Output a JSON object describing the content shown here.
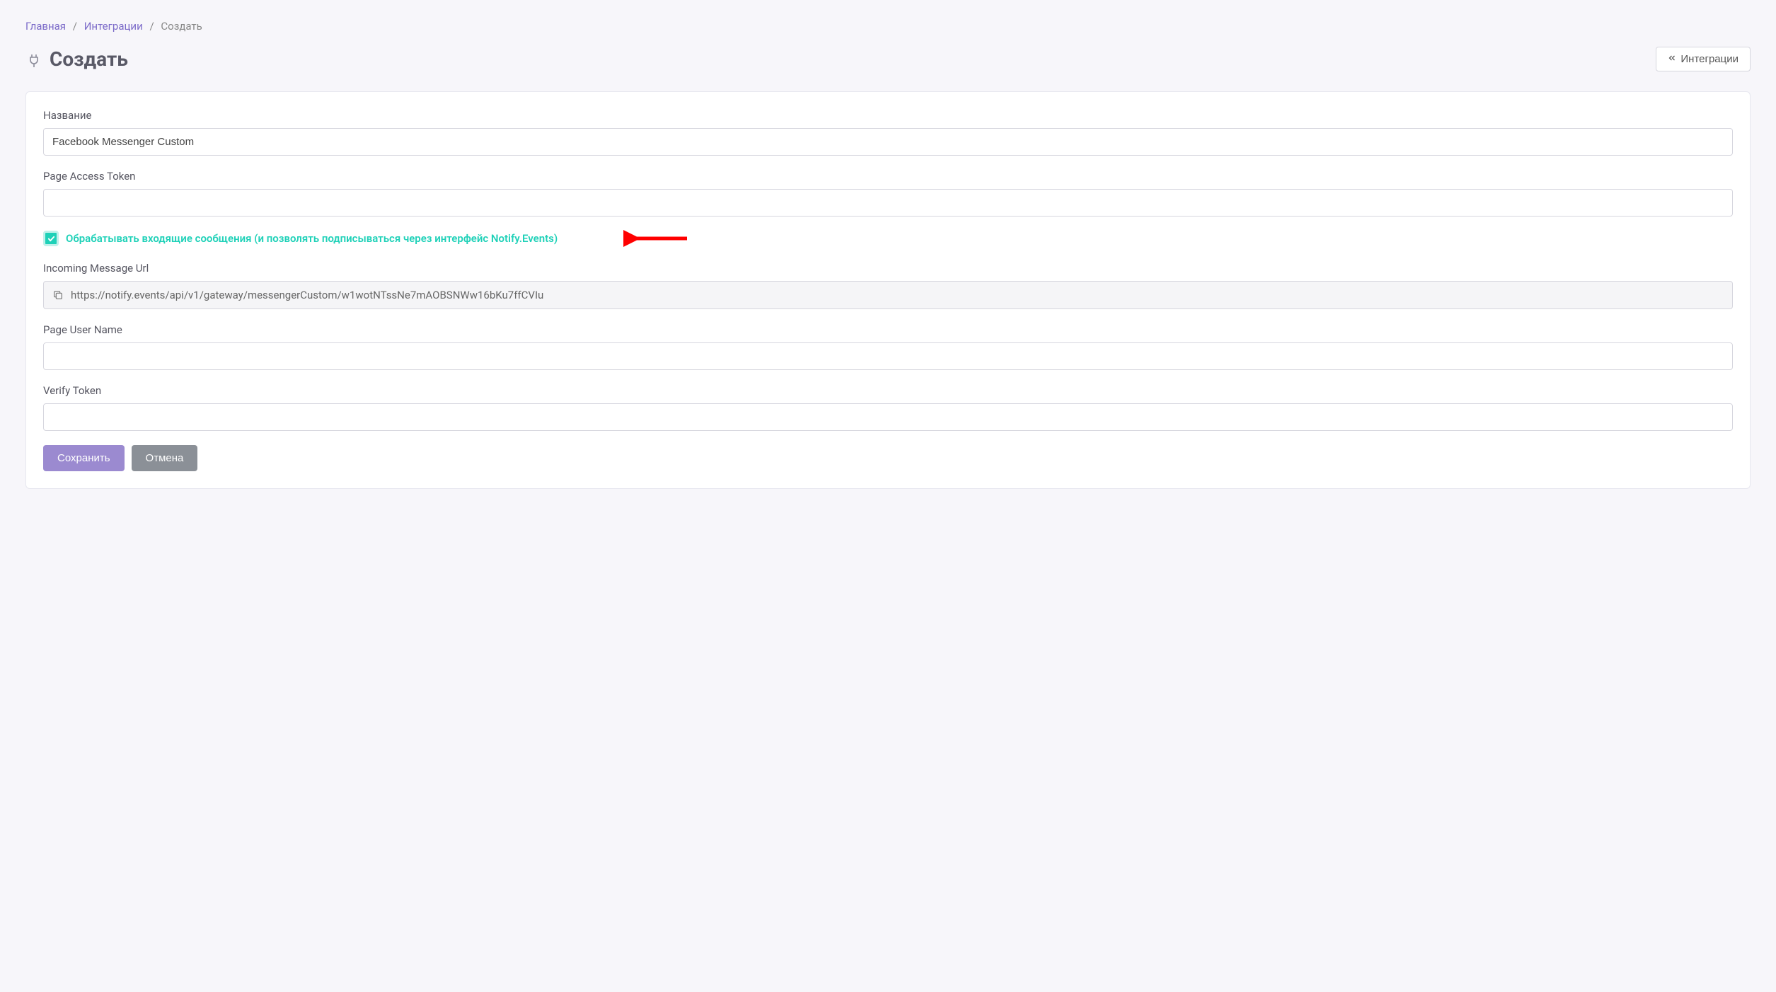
{
  "breadcrumb": {
    "home": "Главная",
    "integrations": "Интеграции",
    "current": "Создать"
  },
  "page": {
    "title": "Создать"
  },
  "back_button": {
    "label": "Интеграции"
  },
  "form": {
    "name": {
      "label": "Название",
      "value": "Facebook Messenger Custom"
    },
    "page_access_token": {
      "label": "Page Access Token",
      "value": ""
    },
    "incoming_checkbox": {
      "label": "Обрабатывать входящие сообщения (и позволять подписываться через интерфейс Notify.Events)",
      "checked": true
    },
    "incoming_url": {
      "label": "Incoming Message Url",
      "value": "https://notify.events/api/v1/gateway/messengerCustom/w1wotNTssNe7mAOBSNWw16bKu7ffCVIu"
    },
    "page_user_name": {
      "label": "Page User Name",
      "value": ""
    },
    "verify_token": {
      "label": "Verify Token",
      "value": ""
    }
  },
  "buttons": {
    "save": "Сохранить",
    "cancel": "Отмена"
  }
}
